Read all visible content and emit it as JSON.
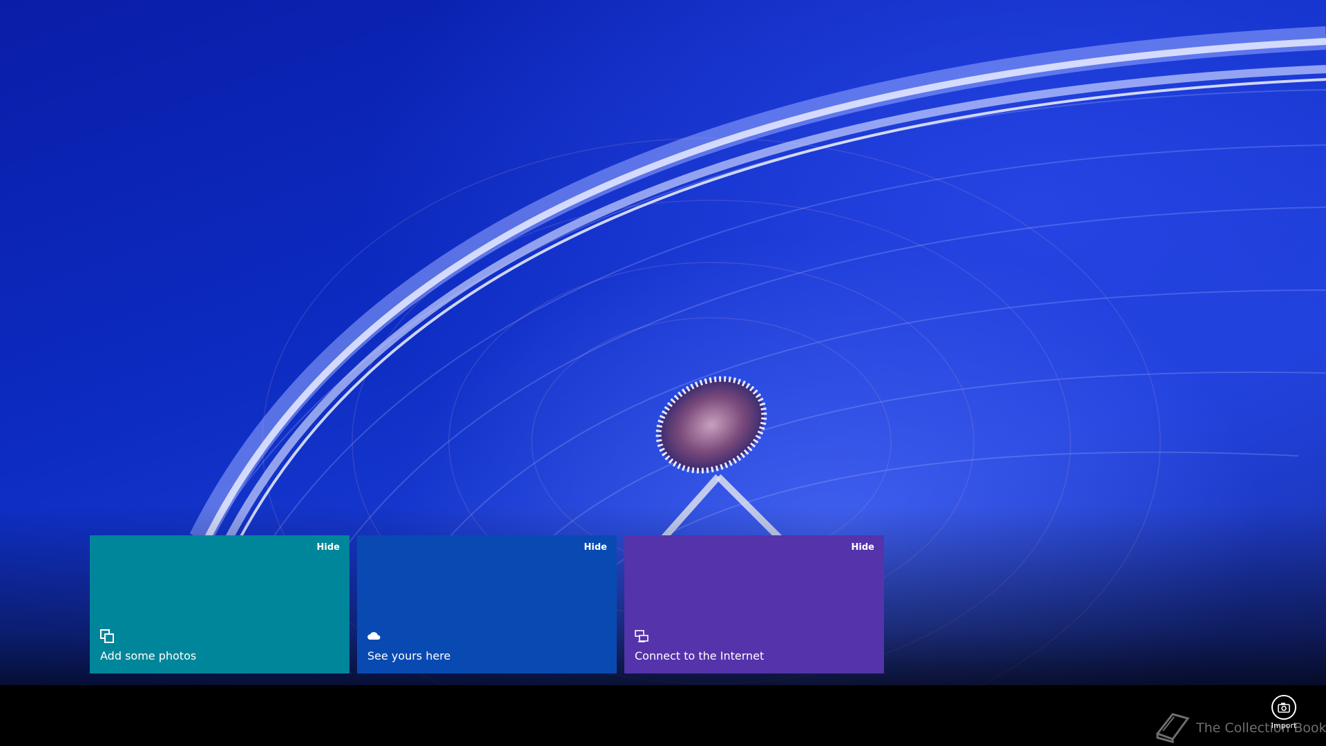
{
  "tiles": [
    {
      "label": "Add some photos",
      "hide": "Hide",
      "icon": "photos-icon",
      "color": "#00869a"
    },
    {
      "label": "See yours here",
      "hide": "Hide",
      "icon": "onedrive-cloud-icon",
      "color": "#094ab2"
    },
    {
      "label": "Connect to the Internet",
      "hide": "Hide",
      "icon": "network-icon",
      "color": "#5533aa"
    }
  ],
  "app_bar": {
    "import_label": "Import",
    "import_icon": "camera-import-icon"
  },
  "watermark": {
    "text": "The Collection Book",
    "icon": "book-icon"
  }
}
